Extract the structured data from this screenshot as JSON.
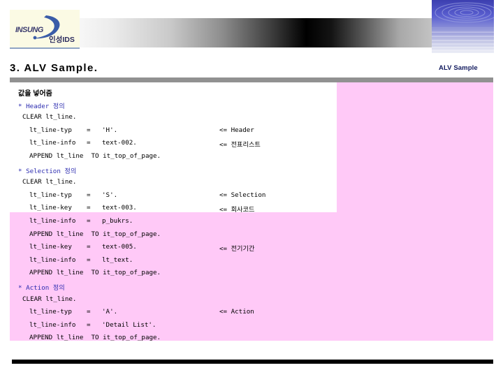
{
  "slide": {
    "title": "3. ALV Sample.",
    "corner_label": "ALV Sample",
    "logo": {
      "wordmark": "INSUNG",
      "korean": "인성IDS",
      "icon": "swoosh-icon"
    },
    "hero_image_alt": "water-ripple-photo"
  },
  "content": {
    "intro_heading": "값을 넣어줌",
    "lines": [
      {
        "type": "comment",
        "indent": 0,
        "text": "* Header 정의",
        "note": ""
      },
      {
        "type": "code",
        "indent": 1,
        "text": "CLEAR lt_line.",
        "note": ""
      },
      {
        "type": "assign",
        "indent": 2,
        "lhs": "lt_line-typ",
        "op": "=",
        "rhs": "'H'.",
        "note": "<= Header"
      },
      {
        "type": "assign",
        "indent": 2,
        "lhs": "lt_line-info",
        "op": "=",
        "rhs": "text-002.",
        "note": "<= 전표리스트"
      },
      {
        "type": "code",
        "indent": 2,
        "text": "APPEND lt_line  TO it_top_of_page.",
        "note": ""
      },
      {
        "type": "comment",
        "indent": 0,
        "text": "* Selection 정의",
        "note": ""
      },
      {
        "type": "code",
        "indent": 1,
        "text": "CLEAR lt_line.",
        "note": ""
      },
      {
        "type": "assign",
        "indent": 2,
        "lhs": "lt_line-typ",
        "op": "=",
        "rhs": "'S'.",
        "note": "<= Selection"
      },
      {
        "type": "assign",
        "indent": 2,
        "lhs": "lt_line-key",
        "op": "=",
        "rhs": "text-003.",
        "note": "<= 회사코드"
      },
      {
        "type": "assign",
        "indent": 2,
        "lhs": "lt_line-info",
        "op": "=",
        "rhs": "p_bukrs.",
        "note": ""
      },
      {
        "type": "code",
        "indent": 2,
        "text": "APPEND lt_line  TO it_top_of_page.",
        "note": ""
      },
      {
        "type": "assign",
        "indent": 2,
        "lhs": "lt_line-key",
        "op": "=",
        "rhs": "text-005.",
        "note": "<= 전기기간"
      },
      {
        "type": "assign",
        "indent": 2,
        "lhs": "lt_line-info",
        "op": "=",
        "rhs": "lt_text.",
        "note": ""
      },
      {
        "type": "code",
        "indent": 2,
        "text": "APPEND lt_line  TO it_top_of_page.",
        "note": ""
      },
      {
        "type": "comment",
        "indent": 0,
        "text": "* Action 정의",
        "note": ""
      },
      {
        "type": "code",
        "indent": 1,
        "text": "CLEAR lt_line.",
        "note": ""
      },
      {
        "type": "assign",
        "indent": 2,
        "lhs": "lt_line-typ",
        "op": "=",
        "rhs": "'A'.",
        "note": "<= Action"
      },
      {
        "type": "assign",
        "indent": 2,
        "lhs": "lt_line-info",
        "op": "=",
        "rhs": "'Detail List'.",
        "note": ""
      },
      {
        "type": "code",
        "indent": 2,
        "text": "APPEND lt_line  TO it_top_of_page.",
        "note": ""
      }
    ]
  },
  "colors": {
    "pink_pane": "#ffc9f7",
    "white_pane": "#ffffff",
    "rule_gray": "#919191",
    "comment_blue": "#2d2db0",
    "corner_navy": "#111a5e",
    "logo_cream": "#fbfae4",
    "logo_blue": "#3a5ca8",
    "bottom_bar": "#000000"
  }
}
